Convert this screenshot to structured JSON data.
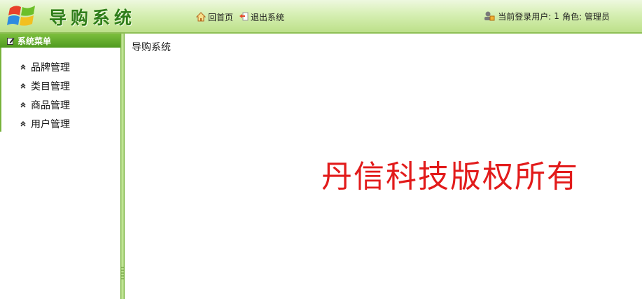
{
  "app": {
    "title": "导购系统"
  },
  "nav": {
    "home_label": "回首页",
    "logout_label": "退出系统"
  },
  "user": {
    "info_label": "当前登录用户:",
    "user_id": "1",
    "role_label": "角色:",
    "role": "管理员"
  },
  "sidebar": {
    "title": "系统菜单",
    "items": [
      {
        "label": "品牌管理"
      },
      {
        "label": "类目管理"
      },
      {
        "label": "商品管理"
      },
      {
        "label": "用户管理"
      }
    ]
  },
  "main": {
    "page_title": "导购系统",
    "copyright": "丹信科技版权所有"
  },
  "colors": {
    "header_gradient_top": "#eef8df",
    "header_gradient_bottom": "#bde08a",
    "accent_green": "#4f9a1f",
    "copyright_red": "#e21b1b"
  },
  "icons": {
    "logo": "windows-logo-icon",
    "home": "home-icon",
    "logout": "exit-icon",
    "user": "user-lock-icon",
    "menu": "edit-note-icon",
    "menu_item": "double-chevron-up-icon"
  }
}
